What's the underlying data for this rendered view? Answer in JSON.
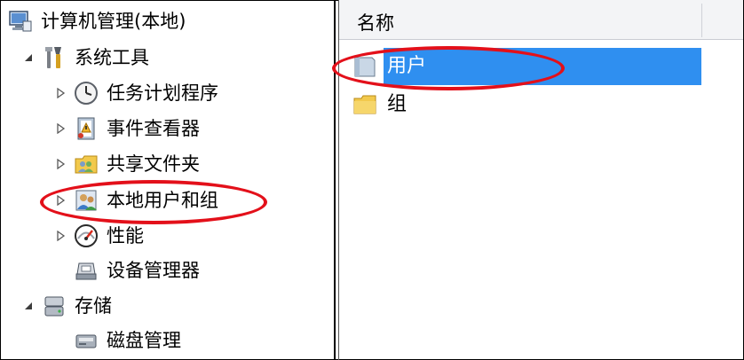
{
  "tree": {
    "root": {
      "label": "计算机管理(本地)",
      "icon": "computer-management-icon"
    },
    "system_tools": {
      "label": "系统工具",
      "icon": "tools-icon",
      "expander": "expanded"
    },
    "task_scheduler": {
      "label": "任务计划程序",
      "icon": "clock-icon",
      "expander": "collapsed"
    },
    "event_viewer": {
      "label": "事件查看器",
      "icon": "event-viewer-icon",
      "expander": "collapsed"
    },
    "shared_folders": {
      "label": "共享文件夹",
      "icon": "shared-folder-icon",
      "expander": "collapsed"
    },
    "local_users_groups": {
      "label": "本地用户和组",
      "icon": "users-icon",
      "expander": "collapsed",
      "annotated": true
    },
    "performance": {
      "label": "性能",
      "icon": "performance-icon",
      "expander": "collapsed"
    },
    "device_manager": {
      "label": "设备管理器",
      "icon": "device-manager-icon"
    },
    "storage": {
      "label": "存储",
      "icon": "storage-icon",
      "expander": "expanded"
    },
    "disk_management": {
      "label": "磁盘管理",
      "icon": "disk-icon"
    }
  },
  "list": {
    "column_header": "名称",
    "items": [
      {
        "label": "用户",
        "icon": "folder-icon",
        "selected": true,
        "annotated": true
      },
      {
        "label": "组",
        "icon": "folder-icon",
        "selected": false
      }
    ]
  },
  "colors": {
    "selection": "#2f8ff0",
    "annotation": "#e3101a"
  }
}
